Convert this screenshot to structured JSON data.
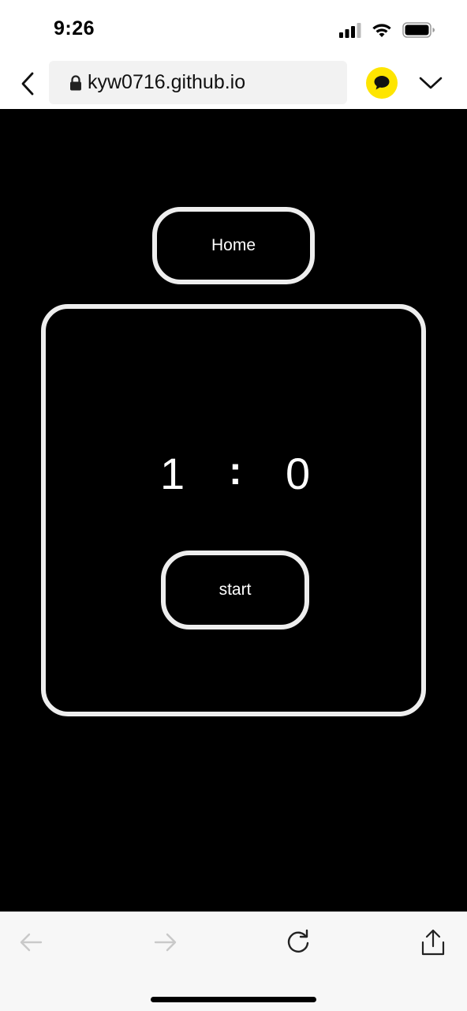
{
  "status_bar": {
    "time": "9:26",
    "icons": [
      "cellular-signal-icon",
      "wifi-icon",
      "battery-icon"
    ]
  },
  "browser": {
    "url": "kyw0716.github.io",
    "icons": [
      "back-chevron-icon",
      "lock-icon",
      "kakaotalk-chat-icon",
      "chevron-down-icon"
    ],
    "kakao_color": "#fee500"
  },
  "page": {
    "home_label": "Home",
    "score": {
      "left": "1",
      "separator": ":",
      "right": "0"
    },
    "start_label": "start",
    "background_color": "#000000",
    "border_color": "#eeeeee"
  },
  "bottom_toolbar": {
    "icons": [
      "back-arrow-icon",
      "forward-arrow-icon",
      "reload-icon",
      "share-icon"
    ]
  }
}
